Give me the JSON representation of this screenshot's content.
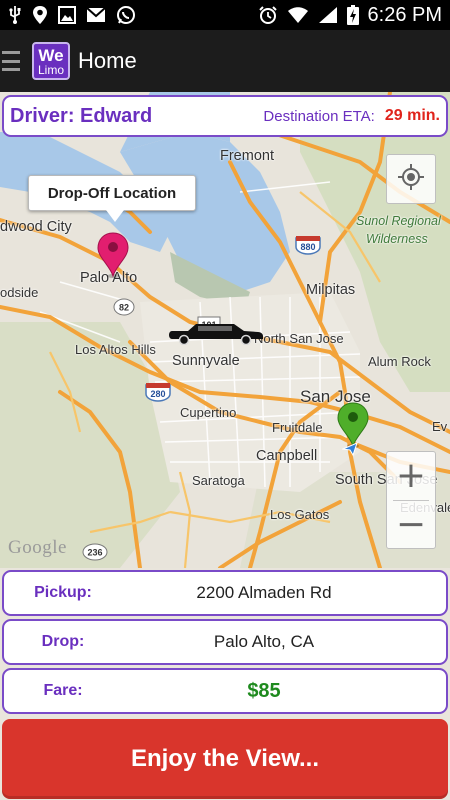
{
  "status_bar": {
    "time": "6:26 PM",
    "icons": [
      "usb-icon",
      "location-icon",
      "image-icon",
      "gmail-icon",
      "whatsapp-icon",
      "alarm-icon",
      "wifi-icon",
      "signal-icon",
      "battery-charging-icon"
    ]
  },
  "action_bar": {
    "logo_line1": "We",
    "logo_line2": "Limo",
    "title": "Home"
  },
  "driver_bar": {
    "driver": "Driver: Edward",
    "eta_label": "Destination ETA:",
    "eta_value": "29 min."
  },
  "map": {
    "callout": "Drop-Off Location",
    "attribution": "Google",
    "zoom_in": "+",
    "zoom_out": "−",
    "labels": {
      "fremont": "Fremont",
      "redwood_city": "dwood City",
      "sunol": "Sunol Regional",
      "wilderness": "Wilderness",
      "palo_alto": "Palo Alto",
      "milpitas": "Milpitas",
      "odside": "odside",
      "north_san_jose": "North San Jose",
      "los_altos_hills": "Los Altos Hills",
      "sunnyvale": "Sunnyvale",
      "alum_rock": "Alum Rock",
      "san_jose": "San Jose",
      "cupertino": "Cupertino",
      "ev": "Ev",
      "fruitdale": "Fruitdale",
      "campbell": "Campbell",
      "saratoga": "Saratoga",
      "south_san_jose": "South San Jose",
      "los_gatos": "Los Gatos",
      "edenvale": "Edenvale"
    },
    "shields": {
      "i880": "880",
      "r82": "82",
      "r101": "101",
      "i280": "280",
      "r236": "236"
    }
  },
  "trip": {
    "pickup_label": "Pickup:",
    "pickup_value": "2200 Almaden Rd",
    "drop_label": "Drop:",
    "drop_value": "Palo Alto, CA",
    "fare_label": "Fare:",
    "fare_value": "$85"
  },
  "cta": {
    "label": "Enjoy the View..."
  },
  "colors": {
    "brand_purple": "#6a2fbf",
    "eta_red": "#e0231b",
    "fare_green": "#1e8a1e",
    "cta_red": "#d9352c",
    "highway_orange": "#f2a33a",
    "water_blue": "#a8c8e8"
  }
}
